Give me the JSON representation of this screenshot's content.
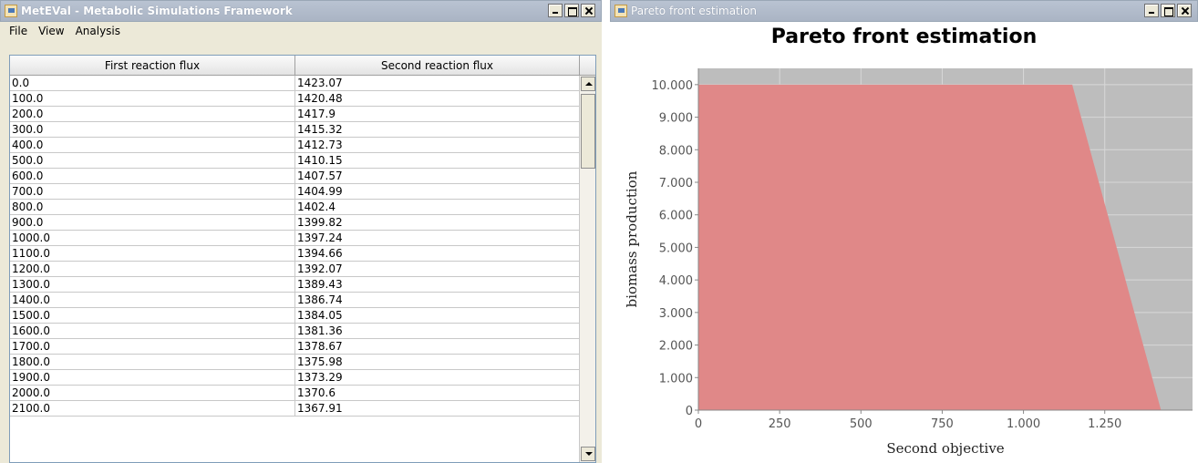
{
  "left_window": {
    "title": "MetEVal - Metabolic Simulations Framework",
    "menu": [
      "File",
      "View",
      "Analysis"
    ],
    "table": {
      "columns": [
        "First reaction flux",
        "Second reaction flux"
      ],
      "rows": [
        [
          "0.0",
          "1423.07"
        ],
        [
          "100.0",
          "1420.48"
        ],
        [
          "200.0",
          "1417.9"
        ],
        [
          "300.0",
          "1415.32"
        ],
        [
          "400.0",
          "1412.73"
        ],
        [
          "500.0",
          "1410.15"
        ],
        [
          "600.0",
          "1407.57"
        ],
        [
          "700.0",
          "1404.99"
        ],
        [
          "800.0",
          "1402.4"
        ],
        [
          "900.0",
          "1399.82"
        ],
        [
          "1000.0",
          "1397.24"
        ],
        [
          "1100.0",
          "1394.66"
        ],
        [
          "1200.0",
          "1392.07"
        ],
        [
          "1300.0",
          "1389.43"
        ],
        [
          "1400.0",
          "1386.74"
        ],
        [
          "1500.0",
          "1384.05"
        ],
        [
          "1600.0",
          "1381.36"
        ],
        [
          "1700.0",
          "1378.67"
        ],
        [
          "1800.0",
          "1375.98"
        ],
        [
          "1900.0",
          "1373.29"
        ],
        [
          "2000.0",
          "1370.6"
        ],
        [
          "2100.0",
          "1367.91"
        ]
      ]
    }
  },
  "right_window": {
    "title": "Pareto front estimation"
  },
  "chart_data": {
    "type": "area",
    "title": "Pareto front estimation",
    "xlabel": "Second objective",
    "ylabel": "biomass production",
    "x": [
      0,
      1150,
      1423
    ],
    "y": [
      10000,
      10000,
      0
    ],
    "xlim": [
      0,
      1520
    ],
    "ylim": [
      0,
      10500
    ],
    "xticks": [
      0,
      250,
      500,
      750,
      1000,
      1250
    ],
    "xtick_labels": [
      "0",
      "250",
      "500",
      "750",
      "1.000",
      "1.250"
    ],
    "yticks": [
      0,
      1000,
      2000,
      3000,
      4000,
      5000,
      6000,
      7000,
      8000,
      9000,
      10000
    ],
    "ytick_labels": [
      "0",
      "1.000",
      "2.000",
      "3.000",
      "4.000",
      "5.000",
      "6.000",
      "7.000",
      "8.000",
      "9.000",
      "10.000"
    ],
    "colors": {
      "fill": "#e08888",
      "background": "#bdbdbd",
      "grid": "#d8d8d8"
    },
    "grid": true
  }
}
